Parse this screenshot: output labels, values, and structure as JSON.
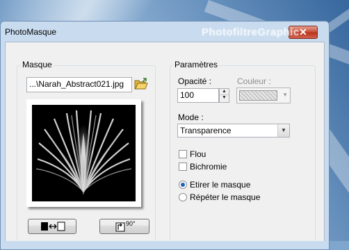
{
  "window": {
    "title": "PhotoMasque",
    "close_glyph": "✕",
    "watermark": "PhotofiltreGraphic"
  },
  "mask": {
    "group_label": "Masque",
    "file_value": "...\\Narah_Abstract021.jpg",
    "folder_icon": "folder-open-icon",
    "invert_button_icon": "swap-icon",
    "rotate_button_icon": "rotate-90-icon",
    "rotate_button_text": "90°"
  },
  "params": {
    "group_label": "Paramètres",
    "opacity_label": "Opacité :",
    "opacity_value": "100",
    "color_label": "Couleur :",
    "mode_label": "Mode :",
    "mode_value": "Transparence",
    "flou_label": "Flou",
    "bichromie_label": "Bichromie",
    "etirer_label": "Etirer le masque",
    "repeter_label": "Répéter le masque",
    "selected_radio": "etirer"
  },
  "colors": {
    "accent": "#1e5fb8",
    "close_red": "#c74a34",
    "client_bg": "#f0f0f0"
  }
}
